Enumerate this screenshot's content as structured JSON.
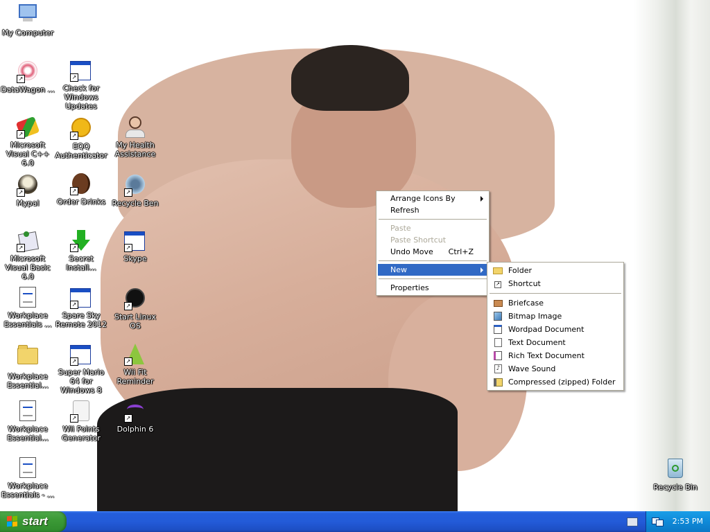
{
  "desktop_icons": [
    {
      "id": "my-computer",
      "label": "My Computer"
    },
    {
      "id": "datawagon",
      "label": "DataWagon ..."
    },
    {
      "id": "check-for-updates",
      "label": "Check for Windows Updates"
    },
    {
      "id": "ms-visual-cpp",
      "label": "Microsoft Visual C++ 6.0"
    },
    {
      "id": "eqq-authenticator",
      "label": "EQQ Authenticator"
    },
    {
      "id": "my-health-assistance",
      "label": "My Health Assistance"
    },
    {
      "id": "mypal",
      "label": "Mypal"
    },
    {
      "id": "order-drinks",
      "label": "Order Drinks"
    },
    {
      "id": "recycle-ben",
      "label": "Recycle Ben"
    },
    {
      "id": "ms-visual-basic",
      "label": "Microsoft Visual Basic 6.0"
    },
    {
      "id": "secret-install",
      "label": "Secret Install..."
    },
    {
      "id": "skype",
      "label": "Skype"
    },
    {
      "id": "workplace-essentials-1",
      "label": "Workplace Essentials ..."
    },
    {
      "id": "spare-sky-remote",
      "label": "Spare Sky Remote 2012"
    },
    {
      "id": "start-linux-os",
      "label": "Start Linux OS"
    },
    {
      "id": "workplace-essentials-2",
      "label": "Workplace Essential..."
    },
    {
      "id": "super-mario",
      "label": "Super Mario 64 for Windows 8"
    },
    {
      "id": "wii-fit-reminder",
      "label": "Wii Fit Reminder"
    },
    {
      "id": "workplace-essentials-3",
      "label": "Workplace Essential..."
    },
    {
      "id": "wii-points-generator",
      "label": "Wii Points Generator"
    },
    {
      "id": "dolphin-6",
      "label": "Dolphin 6"
    },
    {
      "id": "workplace-essentials-4",
      "label": "Workplace Essentials - ..."
    },
    {
      "id": "recycle-bin",
      "label": "Recycle Bin"
    }
  ],
  "context_menu": {
    "arrange_icons_by": "Arrange Icons By",
    "refresh": "Refresh",
    "paste": "Paste",
    "paste_shortcut": "Paste Shortcut",
    "undo_move": "Undo Move",
    "undo_move_shortcut": "Ctrl+Z",
    "new": "New",
    "properties": "Properties"
  },
  "new_submenu": {
    "folder": "Folder",
    "shortcut": "Shortcut",
    "briefcase": "Briefcase",
    "bitmap_image": "Bitmap Image",
    "wordpad_document": "Wordpad Document",
    "text_document": "Text Document",
    "rich_text_document": "Rich Text Document",
    "wave_sound": "Wave Sound",
    "compressed_folder": "Compressed (zipped) Folder"
  },
  "taskbar": {
    "start_label": "start",
    "clock": "2:53 PM"
  },
  "colors": {
    "taskbar_blue": "#245edb",
    "start_green": "#3c9a37",
    "menu_highlight": "#316ac5",
    "tray_blue": "#0f8ad8"
  }
}
